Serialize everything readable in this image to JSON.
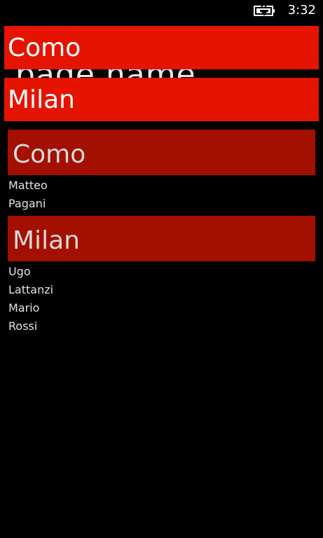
{
  "status_bar": {
    "time": "3:32",
    "battery_icon": "battery-charging-icon"
  },
  "page_name": "page name",
  "jump_list": [
    {
      "label": "Como"
    },
    {
      "label": "Milan"
    }
  ],
  "groups": [
    {
      "header": "Como",
      "items": [
        "Matteo",
        "Pagani"
      ]
    },
    {
      "header": "Milan",
      "items": [
        "Ugo",
        "Lattanzi",
        "Mario",
        "Rossi"
      ]
    }
  ],
  "colors": {
    "accent": "#e51400",
    "group_header": "#a31000",
    "background": "#000000"
  }
}
